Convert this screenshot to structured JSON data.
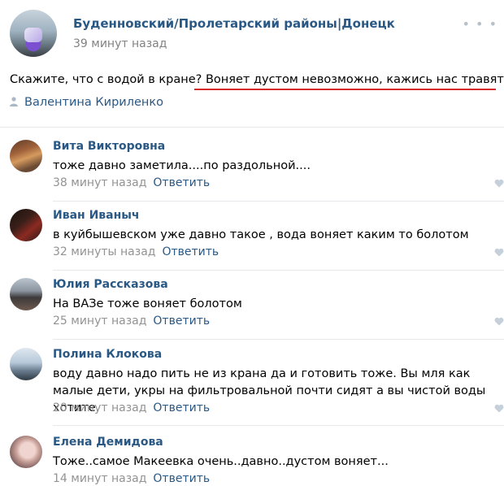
{
  "post": {
    "group_name": "Буденновский/Пролетарский районы|Донецк",
    "time": "39 минут назад",
    "text_plain": "Скажите, что с водой в кране? ",
    "text_highlighted": "Воняет дустом невозможно, кажись нас травят...",
    "author": "Валентина Кириленко",
    "more_icon": "more-dots-icon",
    "author_icon": "user-icon",
    "underline_color": "#d62a2a"
  },
  "comments": [
    {
      "name": "Вита Викторовна",
      "text": "тоже давно заметила....по раздольной....",
      "time": "38 минут назад",
      "reply": "Ответить"
    },
    {
      "name": "Иван Иваныч",
      "text": "в куйбышевском уже давно такое , вода воняет каким то болотом",
      "time": "32 минуты назад",
      "reply": "Ответить"
    },
    {
      "name": "Юлия Рассказова",
      "text": "На ВАЗе тоже воняет болотом",
      "time": "25 минут назад",
      "reply": "Ответить"
    },
    {
      "name": "Полина Клокова",
      "text": "воду давно надо пить не из крана да и готовить тоже. Вы мля как малые дети, укры на фильтровальной почти сидят а вы чистой воды хотите.",
      "time": "20 минут назад",
      "reply": "Ответить"
    },
    {
      "name": "Елена Демидова",
      "text": "Тоже..самое Макеевка очень..давно..дустом воняет...",
      "time": "14 минут назад",
      "reply": "Ответить"
    }
  ],
  "colors": {
    "link": "#2a5885",
    "meta": "#939393",
    "divider": "#e7e8ec"
  }
}
